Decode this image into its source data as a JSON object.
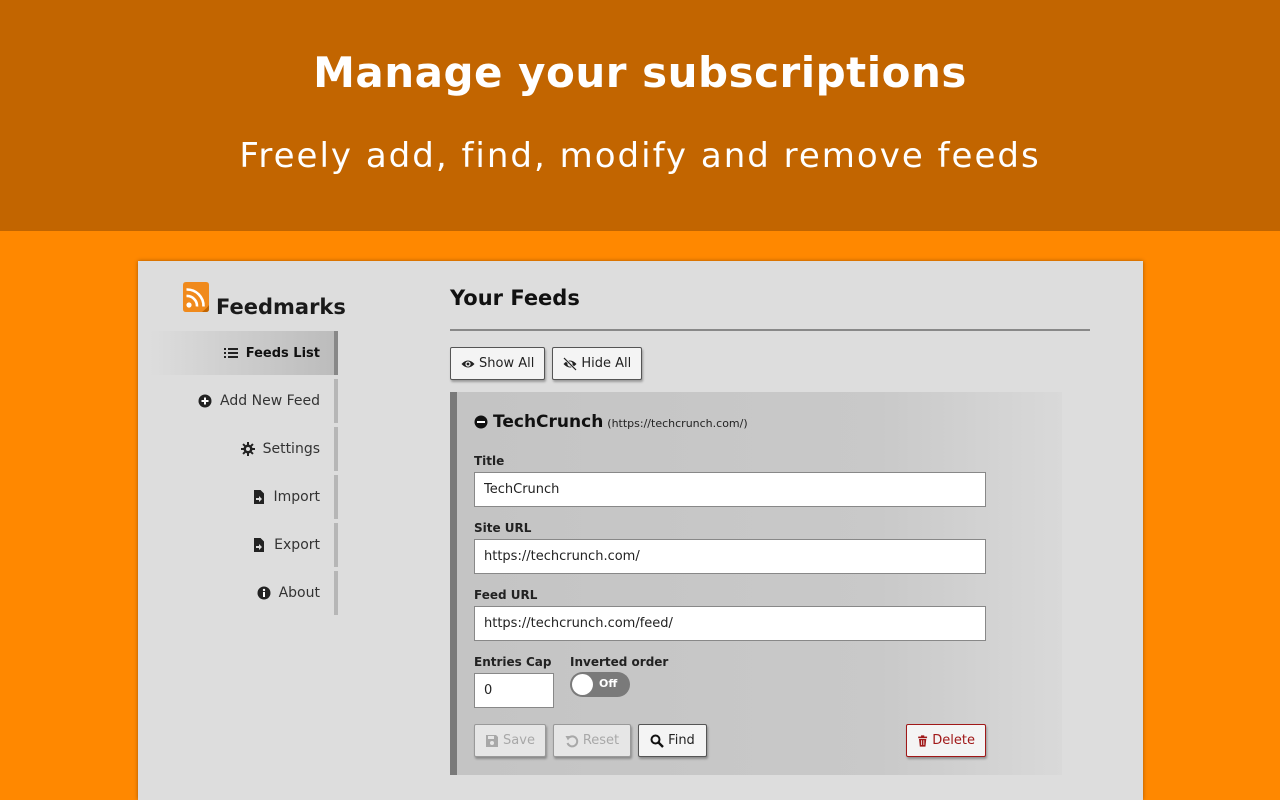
{
  "banner": {
    "title": "Manage your subscriptions",
    "subtitle": "Freely add, find, modify and remove feeds"
  },
  "app": {
    "name": "Feedmarks",
    "nav": [
      {
        "label": "Feeds List",
        "icon": "list-icon",
        "active": true
      },
      {
        "label": "Add New Feed",
        "icon": "plus-circle-icon",
        "active": false
      },
      {
        "label": "Settings",
        "icon": "gear-icon",
        "active": false
      },
      {
        "label": "Import",
        "icon": "file-import-icon",
        "active": false
      },
      {
        "label": "Export",
        "icon": "file-export-icon",
        "active": false
      },
      {
        "label": "About",
        "icon": "info-circle-icon",
        "active": false
      }
    ]
  },
  "main": {
    "heading": "Your Feeds",
    "show_all_label": "Show All",
    "hide_all_label": "Hide All"
  },
  "feed": {
    "title": "TechCrunch",
    "url": "(https://techcrunch.com/)",
    "fields": {
      "title_label": "Title",
      "title_value": "TechCrunch",
      "site_url_label": "Site URL",
      "site_url_value": "https://techcrunch.com/",
      "feed_url_label": "Feed URL",
      "feed_url_value": "https://techcrunch.com/feed/",
      "entries_cap_label": "Entries Cap",
      "entries_cap_value": "0",
      "inverted_order_label": "Inverted order",
      "inverted_order_state": "Off"
    },
    "buttons": {
      "save": "Save",
      "reset": "Reset",
      "find": "Find",
      "delete": "Delete"
    }
  },
  "colors": {
    "banner": "#c26500",
    "page": "#ff8800",
    "panel": "#dddddd",
    "danger": "#a01818"
  }
}
